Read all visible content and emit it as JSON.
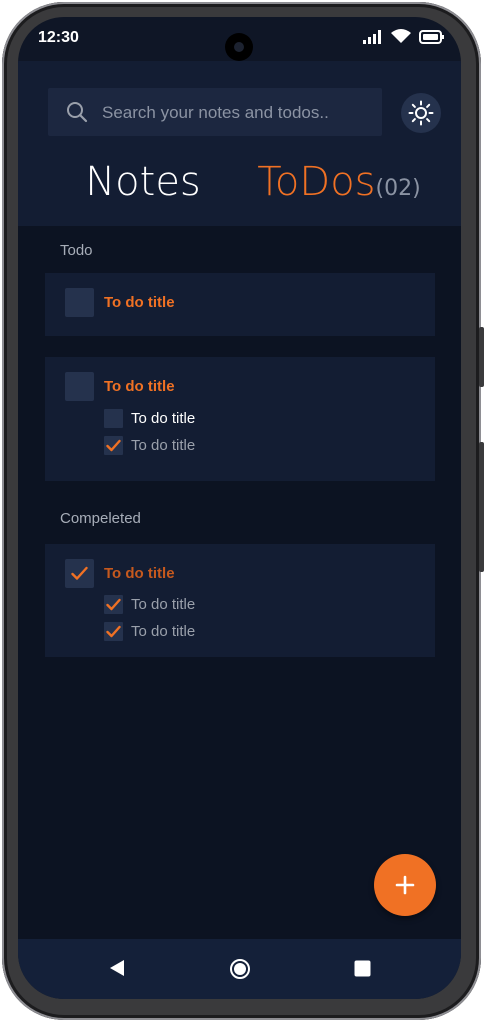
{
  "status": {
    "time": "12:30"
  },
  "search": {
    "placeholder": "Search your notes and todos.."
  },
  "tabs": {
    "notes_label": "Notes",
    "todos_label": "ToDos",
    "todos_count": "(02)"
  },
  "sections": {
    "todo_label": "Todo",
    "completed_label": "Compeleted"
  },
  "todo_cards": [
    {
      "title": "To do title",
      "checked": false,
      "items": []
    },
    {
      "title": "To do title",
      "checked": false,
      "items": [
        {
          "label": "To do title",
          "checked": false
        },
        {
          "label": "To do title",
          "checked": true
        }
      ]
    }
  ],
  "completed_cards": [
    {
      "title": "To do title",
      "checked": true,
      "items": [
        {
          "label": "To do title",
          "checked": true
        },
        {
          "label": "To do title",
          "checked": true
        }
      ]
    }
  ],
  "colors": {
    "accent": "#f07124",
    "background": "#0c1322",
    "card": "#131d33",
    "checkbox": "#25324d"
  },
  "icons": {
    "search": "search-icon",
    "theme": "sun-icon",
    "fab": "plus-icon",
    "nav_back": "back-triangle-icon",
    "nav_home": "home-circle-icon",
    "nav_recents": "recents-square-icon"
  }
}
